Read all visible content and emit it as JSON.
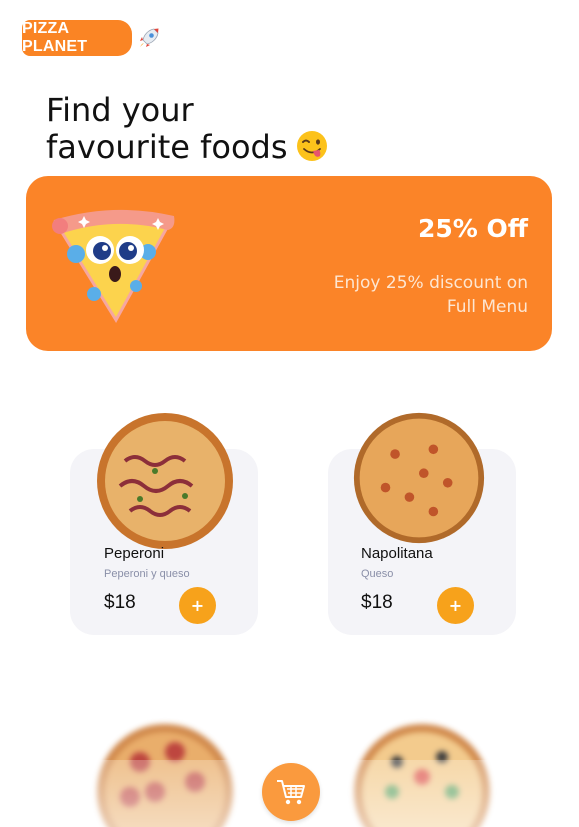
{
  "header": {
    "logo_text": "PIZZA PLANET",
    "logo_icon": "rocket-icon"
  },
  "headline": {
    "line1": "Find your",
    "line2": "favourite foods",
    "emoji_icon": "winking-tongue-emoji-icon"
  },
  "promo": {
    "title": "25% Off",
    "text": "Enjoy 25% discount on Full Menu",
    "image_icon": "happy-pizza-slice-icon"
  },
  "products": [
    {
      "name": "Peperoni",
      "description": "Peperoni y queso",
      "price": "$18",
      "add_label": "+"
    },
    {
      "name": "Napolitana",
      "description": "Queso",
      "price": "$18",
      "add_label": "+"
    }
  ],
  "cart": {
    "icon": "shopping-cart-icon"
  },
  "colors": {
    "brand_orange": "#fb8428",
    "button_orange": "#f7a21b",
    "card_bg": "#f4f4f8"
  }
}
